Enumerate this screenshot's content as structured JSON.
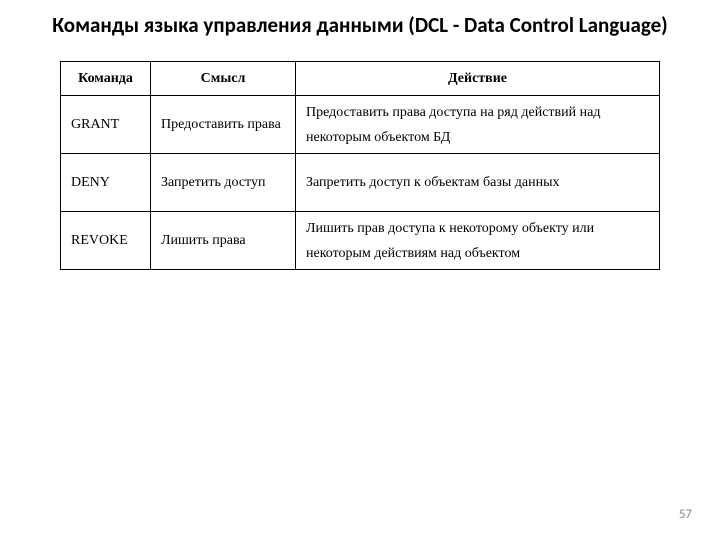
{
  "title": "Команды языка управления данными (DCL - Data Control Language)",
  "table": {
    "headers": {
      "c1": "Команда",
      "c2": "Смысл",
      "c3": "Действие"
    },
    "rows": [
      {
        "cmd": "GRANT",
        "meaning": "Предоставить права",
        "action": "Предоставить права доступа на ряд действий над некоторым объектом БД"
      },
      {
        "cmd": "DENY",
        "meaning": "Запретить доступ",
        "action": "Запретить доступ к объектам базы данных"
      },
      {
        "cmd": "REVOKE",
        "meaning": "Лишить права",
        "action": "Лишить прав доступа к некоторому объекту или некоторым действиям над объектом"
      }
    ]
  },
  "page_number": "57"
}
